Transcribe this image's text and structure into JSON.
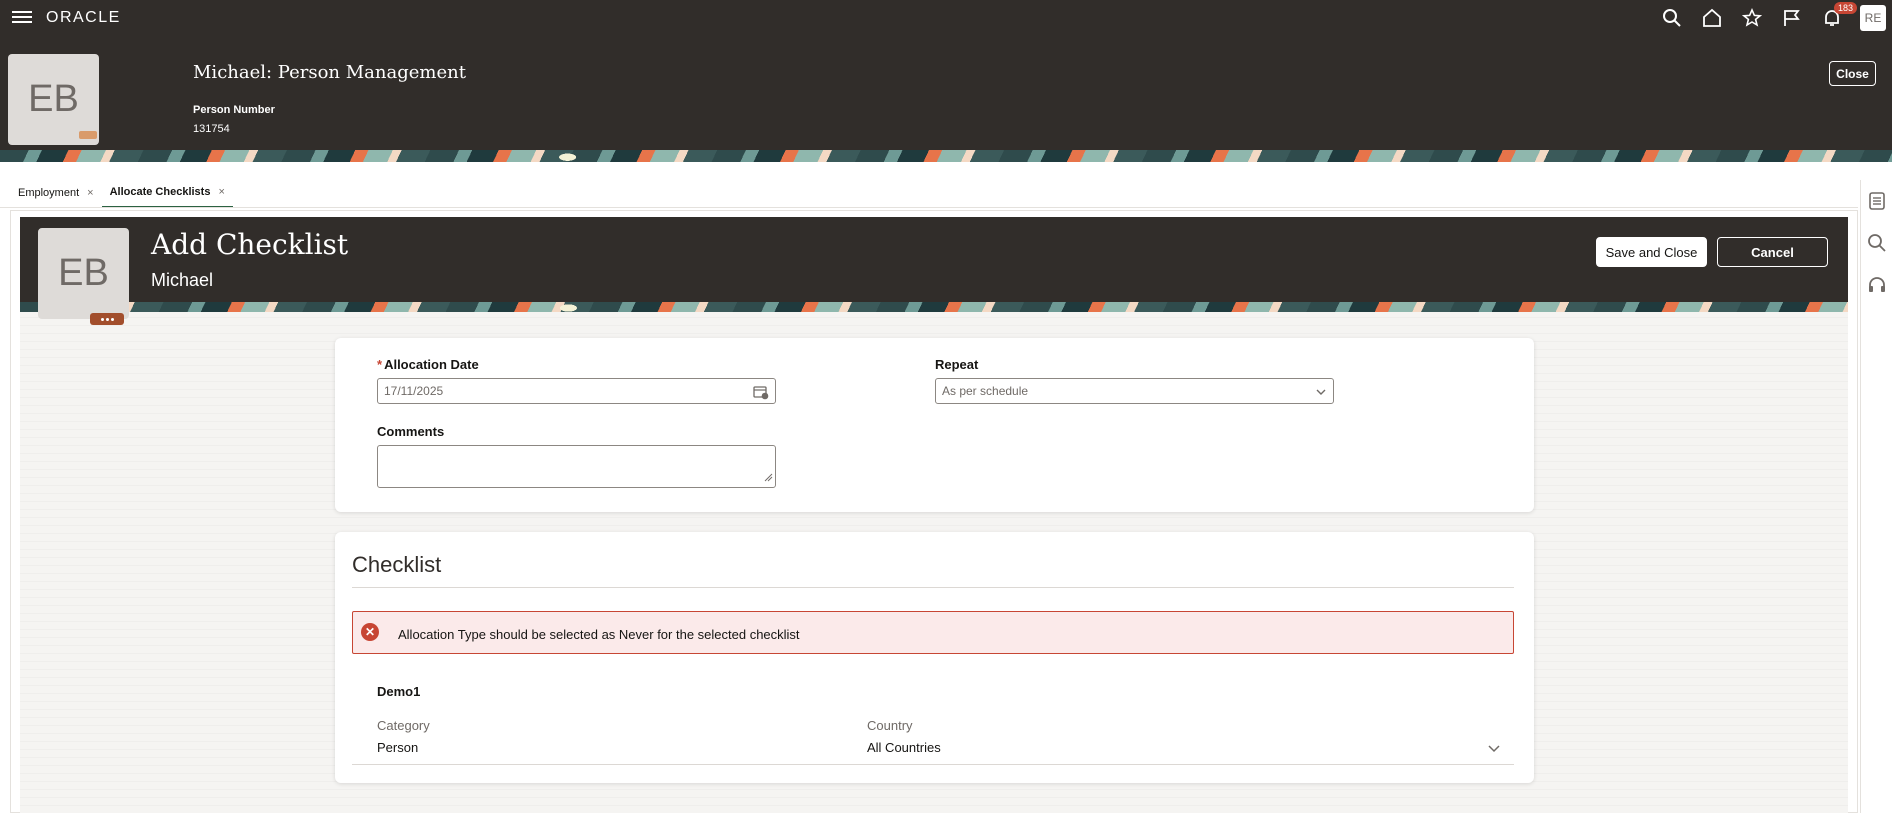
{
  "app": {
    "brand": "ORACLE",
    "notification_count": "183",
    "user_initials": "RE"
  },
  "header": {
    "title": "Michael: Person Management",
    "avatar_initials": "EB",
    "person_number_label": "Person Number",
    "person_number": "131754",
    "close_label": "Close"
  },
  "tabs": [
    {
      "label": "Employment",
      "close": "×"
    },
    {
      "label": "Allocate Checklists",
      "close": "×"
    }
  ],
  "subheader": {
    "avatar_initials": "EB",
    "title": "Add Checklist",
    "name": "Michael",
    "save_label": "Save and Close",
    "cancel_label": "Cancel"
  },
  "form": {
    "allocation_date_required": "*",
    "allocation_date_label": "Allocation Date",
    "allocation_date_value": "17/11/2025",
    "repeat_label": "Repeat",
    "repeat_value": "As per schedule",
    "comments_label": "Comments",
    "comments_value": ""
  },
  "checklist": {
    "section_title": "Checklist",
    "error_message": "Allocation Type should be selected as Never for the selected checklist",
    "name": "Demo1",
    "category_label": "Category",
    "category_value": "Person",
    "country_label": "Country",
    "country_value": "All Countries"
  },
  "colors": {
    "header_bg": "#312d2a",
    "error": "#c74634",
    "tab_active": "#2b6242"
  }
}
